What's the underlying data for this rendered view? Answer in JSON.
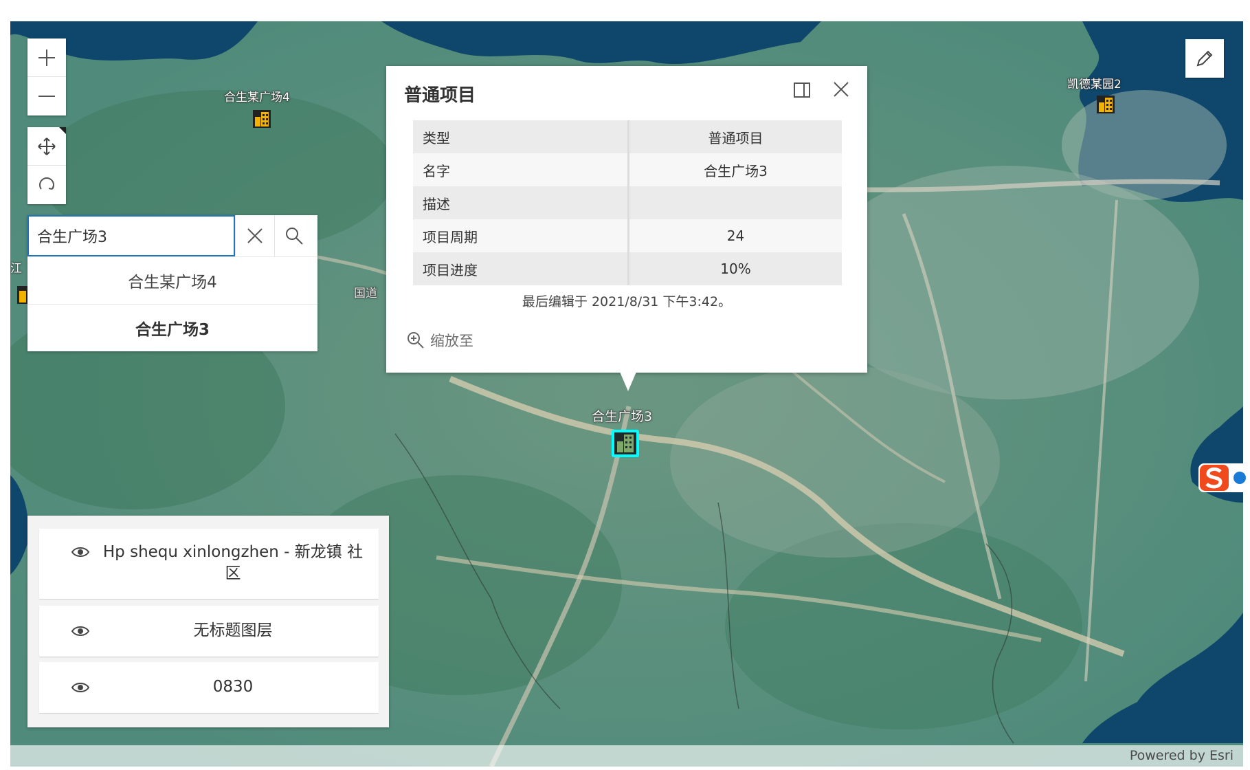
{
  "map": {
    "labels": [
      {
        "id": "p4",
        "text": "合生某广场4"
      },
      {
        "id": "kd2",
        "text": "凯德某园2"
      },
      {
        "id": "p3",
        "text": "合生广场3"
      },
      {
        "id": "road",
        "text": "国道"
      },
      {
        "id": "edge",
        "text": "江"
      }
    ]
  },
  "search": {
    "value": "合生广场3",
    "suggestions": [
      {
        "text": "合生某广场4",
        "bold": false
      },
      {
        "text": "合生广场3",
        "bold": true
      }
    ]
  },
  "popup": {
    "title": "普通项目",
    "fields": [
      {
        "key": "类型",
        "value": "普通项目"
      },
      {
        "key": "名字",
        "value": "合生广场3"
      },
      {
        "key": "描述",
        "value": ""
      },
      {
        "key": "项目周期",
        "value": "24"
      },
      {
        "key": "项目进度",
        "value": "10%"
      }
    ],
    "last_edited": "最后编辑于 2021/8/31 下午3:42。",
    "zoom_to": "缩放至"
  },
  "layers": [
    {
      "title": "Hp shequ xinlongzhen - 新龙镇 社区",
      "visible": true
    },
    {
      "title": "无标题图层",
      "visible": true
    },
    {
      "title": "0830",
      "visible": true
    }
  ],
  "attribution": "Powered by Esri",
  "colors": {
    "water": "#0f466b",
    "land": "#4f8a7a",
    "accent": "#1f75b8",
    "highlight": "#00ffff"
  },
  "icons": [
    "zoom-in-icon",
    "zoom-out-icon",
    "pan-icon",
    "rotate-icon",
    "close-icon",
    "search-icon",
    "dock-icon",
    "zoom-to-icon",
    "eye-icon",
    "pencil-icon",
    "building-icon"
  ]
}
